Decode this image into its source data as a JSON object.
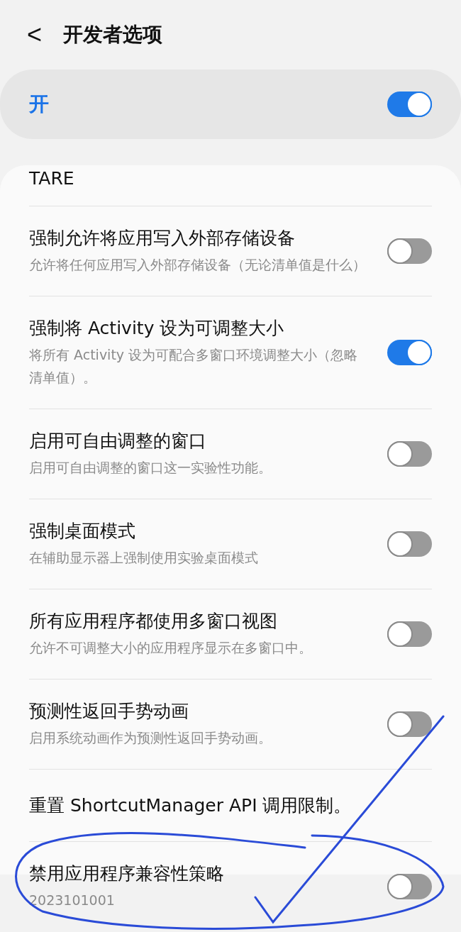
{
  "header": {
    "back": "<",
    "title": "开发者选项"
  },
  "master": {
    "label": "开",
    "on": true
  },
  "items": [
    {
      "kind": "plain",
      "title": "TARE"
    },
    {
      "kind": "toggle",
      "title": "强制允许将应用写入外部存储设备",
      "summary": "允许将任何应用写入外部存储设备（无论清单值是什么）",
      "on": false
    },
    {
      "kind": "toggle",
      "title": "强制将 Activity 设为可调整大小",
      "summary": "将所有 Activity 设为可配合多窗口环境调整大小（忽略清单值）。",
      "on": true
    },
    {
      "kind": "toggle",
      "title": "启用可自由调整的窗口",
      "summary": "启用可自由调整的窗口这一实验性功能。",
      "on": false
    },
    {
      "kind": "toggle",
      "title": "强制桌面模式",
      "summary": "在辅助显示器上强制使用实验桌面模式",
      "on": false
    },
    {
      "kind": "toggle",
      "title": "所有应用程序都使用多窗口视图",
      "summary": "允许不可调整大小的应用程序显示在多窗口中。",
      "on": false
    },
    {
      "kind": "toggle",
      "title": "预测性返回手势动画",
      "summary": "启用系统动画作为预测性返回手势动画。",
      "on": false
    },
    {
      "kind": "plain",
      "title": "重置 ShortcutManager API 调用限制。"
    },
    {
      "kind": "toggle",
      "title": "禁用应用程序兼容性策略",
      "summary": "2023101001",
      "on": false
    }
  ]
}
